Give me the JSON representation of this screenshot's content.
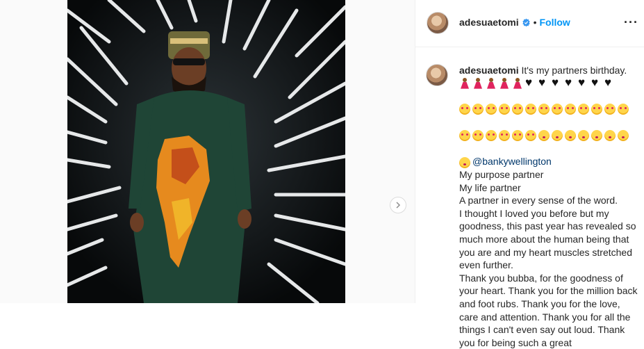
{
  "header": {
    "username": "adesuaetomi",
    "separator": "•",
    "follow_label": "Follow",
    "more_icon": "more-options-icon"
  },
  "post": {
    "image_alt": "Man in green kaftan with Africa map print standing in neon-lit tunnel",
    "next_icon": "chevron-right-icon"
  },
  "caption": {
    "username": "adesuaetomi",
    "intro": "It's my partners birthday.",
    "mention": "@bankywellington",
    "lines": [
      "My purpose partner",
      "My life partner",
      "A partner in every sense of the word.",
      "I thought I loved you before but my goodness, this past year has revealed so much more about the human being that you are and my heart muscles stretched even further.",
      "Thank you bubba, for the goodness of your heart. Thank you for the million back and foot rubs. Thank you for the love, care and attention. Thank you for all the things I can't even say out loud. Thank you for being such a great"
    ]
  },
  "colors": {
    "accent": "#0095f6",
    "text": "#262626",
    "mention": "#00376b",
    "border": "#efefef"
  }
}
